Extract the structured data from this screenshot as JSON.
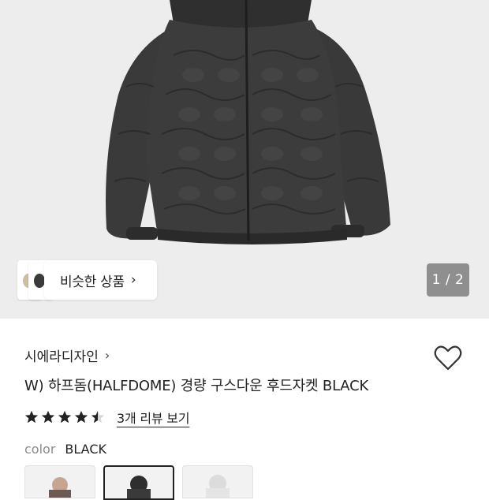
{
  "similar": {
    "label": "비슷한 상품"
  },
  "pager": {
    "text": "1 / 2"
  },
  "product": {
    "brand": "시에라디자인",
    "title": "W) 하프돔(HALFDOME) 경량 구스다운 후드자켓 BLACK",
    "rating": 4.5,
    "reviews_label": "3개 리뷰 보기",
    "color_key": "color",
    "color_value": "BLACK"
  },
  "colors": {
    "hero_bg": "#ededee",
    "jacket": "#3b3b3b",
    "star": "#222222"
  }
}
